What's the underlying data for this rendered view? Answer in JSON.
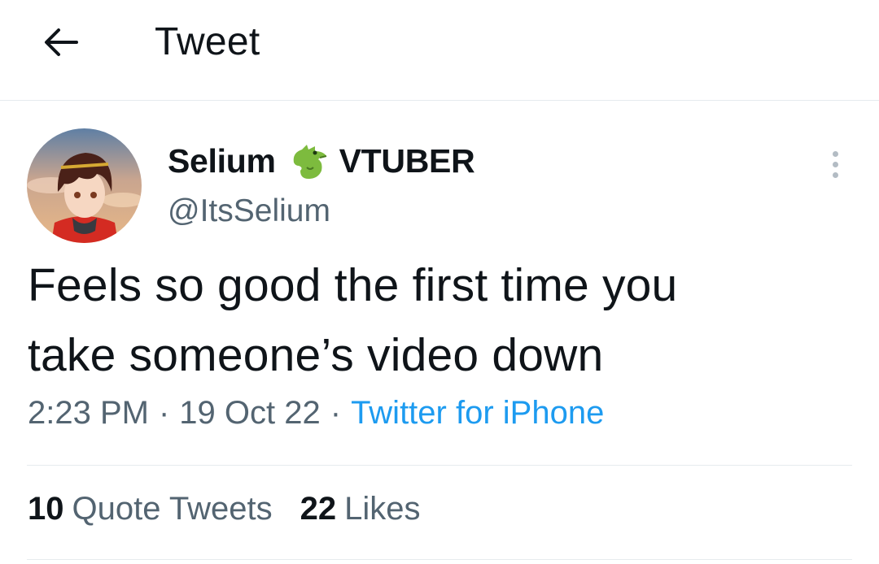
{
  "header": {
    "title": "Tweet",
    "back_icon": "arrow-left-icon"
  },
  "tweet": {
    "author": {
      "name": "Selium",
      "name_emoji": "dragon-emoji",
      "name_suffix": "VTUBER",
      "handle": "@ItsSelium",
      "avatar": "avatar-image"
    },
    "text_line1": "Feels so good the first time you",
    "text_line2": "take someone’s video down",
    "time": "2:23 PM",
    "date": "19 Oct 22",
    "separator": "·",
    "source": "Twitter for iPhone",
    "more_icon": "more-vertical-icon"
  },
  "stats": {
    "quote_count": "10",
    "quote_label": "Quote Tweets",
    "like_count": "22",
    "like_label": "Likes"
  },
  "colors": {
    "text_primary": "#0f1419",
    "text_secondary": "#536471",
    "link": "#1d9bf0",
    "divider": "#e6ebee"
  }
}
